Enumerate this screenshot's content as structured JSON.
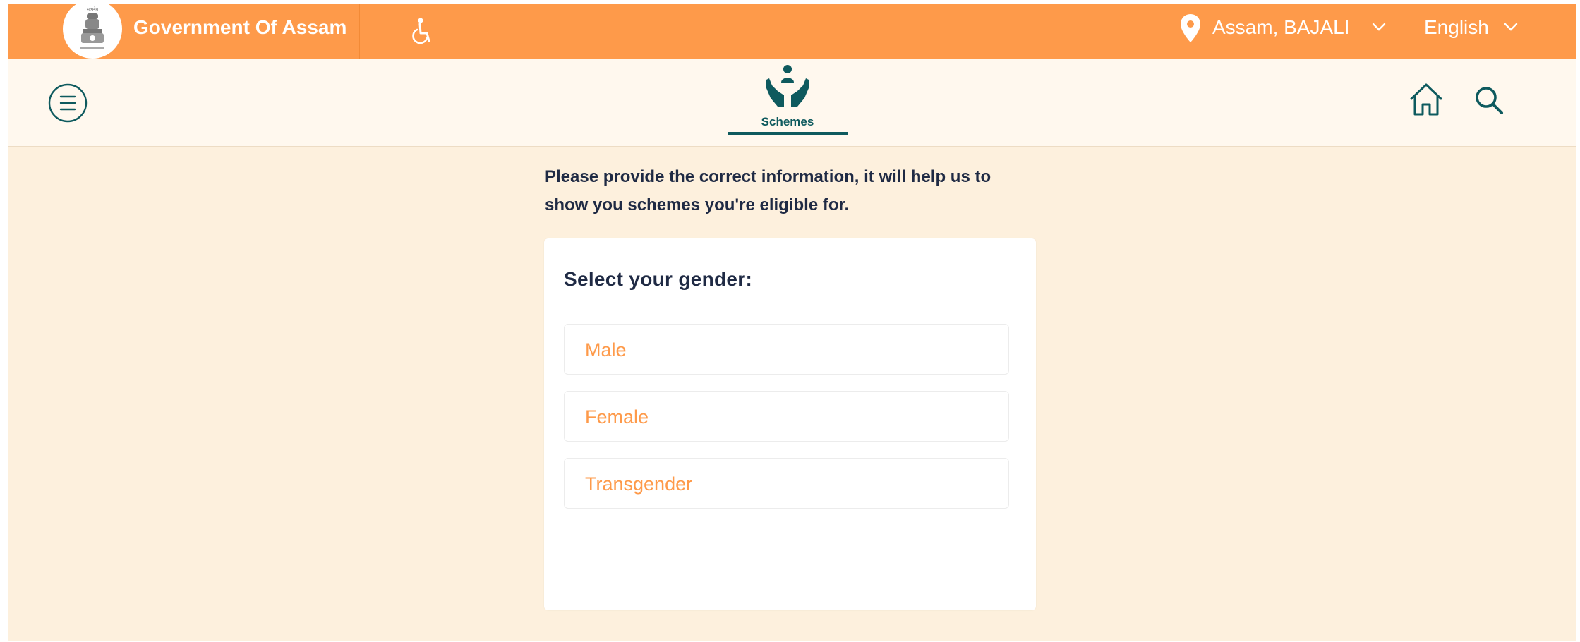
{
  "colors": {
    "topbar": "#fe9a4a",
    "nav_bg": "#fff8ee",
    "page_bg": "#fdf0dd",
    "accent_teal": "#0e5a5e",
    "option_text": "#fe9a4a",
    "heading_text": "#1f2a44"
  },
  "header": {
    "emblem_icon": "state-emblem-icon",
    "government_title": "Government Of Assam",
    "accessibility_icon": "accessibility-icon",
    "location_icon": "map-pin-icon",
    "location": "Assam, BAJALI",
    "language": "English"
  },
  "nav": {
    "menu_icon": "menu-icon",
    "active_tab": "Schemes",
    "home_icon": "home-icon",
    "search_icon": "search-icon"
  },
  "main": {
    "intro_line1": "Please provide the correct information, it will help us to",
    "intro_line2": "show you schemes you're eligible for.",
    "question": "Select your gender:",
    "options": [
      "Male",
      "Female",
      "Transgender"
    ]
  }
}
